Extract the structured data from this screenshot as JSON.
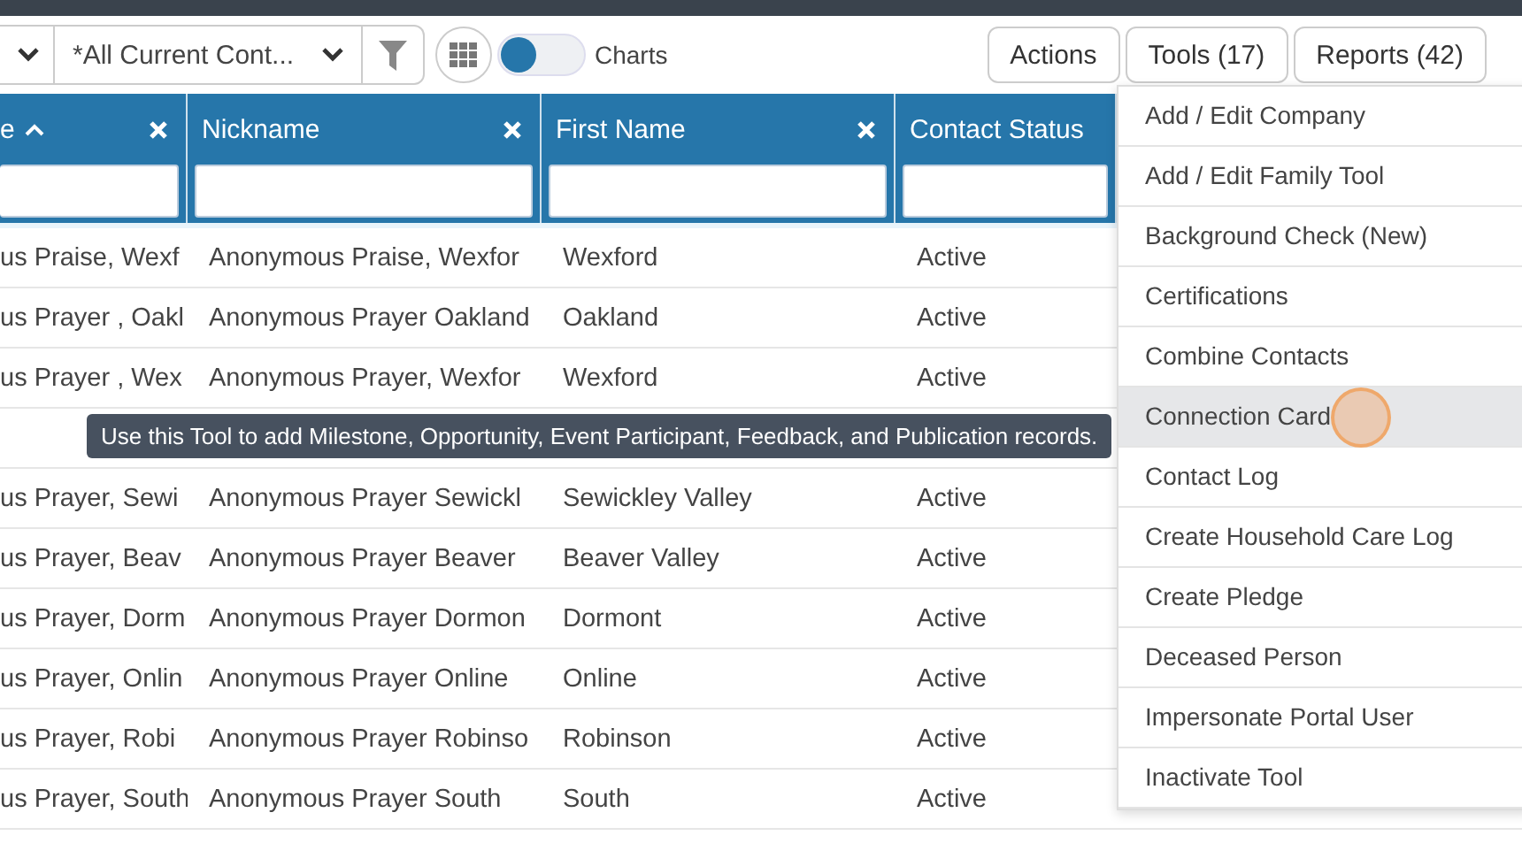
{
  "toolbar": {
    "view_select": {
      "value": "*All Current Cont..."
    },
    "charts_toggle": {
      "label": "Charts",
      "on": false
    },
    "buttons": [
      {
        "label": "Actions"
      },
      {
        "label": "Tools (17)"
      },
      {
        "label": "Reports (42)"
      }
    ]
  },
  "table": {
    "columns": [
      {
        "label": "e",
        "sorted": true,
        "removable": true
      },
      {
        "label": "Nickname",
        "sorted": false,
        "removable": true
      },
      {
        "label": "First Name",
        "sorted": false,
        "removable": true
      },
      {
        "label": "Contact Status",
        "sorted": false,
        "removable": false
      }
    ],
    "rows": [
      {
        "kind": "data",
        "cells": [
          "us Praise, Wexf",
          "Anonymous Praise, Wexfor",
          "Wexford",
          "Active"
        ]
      },
      {
        "kind": "data",
        "cells": [
          "us Prayer , Oakl",
          "Anonymous Prayer Oakland",
          "Oakland",
          "Active"
        ]
      },
      {
        "kind": "data",
        "cells": [
          "us Prayer , Wex",
          "Anonymous Prayer, Wexfor",
          "Wexford",
          "Active"
        ]
      },
      {
        "kind": "covered"
      },
      {
        "kind": "data",
        "cells": [
          "us Prayer, Sewi",
          "Anonymous Prayer Sewickl",
          "Sewickley Valley",
          "Active"
        ]
      },
      {
        "kind": "data",
        "cells": [
          "us Prayer, Beav",
          "Anonymous Prayer Beaver",
          "Beaver Valley",
          "Active"
        ]
      },
      {
        "kind": "data",
        "cells": [
          "us Prayer, Dorm",
          "Anonymous Prayer Dormon",
          "Dormont",
          "Active"
        ]
      },
      {
        "kind": "data",
        "cells": [
          "us Prayer, Onlin",
          "Anonymous Prayer Online",
          "Online",
          "Active"
        ]
      },
      {
        "kind": "data",
        "cells": [
          "us Prayer, Robi",
          "Anonymous Prayer Robinso",
          "Robinson",
          "Active"
        ]
      },
      {
        "kind": "data",
        "cells": [
          "us Prayer, South",
          "Anonymous Prayer South",
          "South",
          "Active"
        ]
      }
    ]
  },
  "tools_menu": {
    "items": [
      {
        "label": "Add / Edit Company",
        "highlighted": false
      },
      {
        "label": "Add / Edit Family Tool",
        "highlighted": false
      },
      {
        "label": "Background Check (New)",
        "highlighted": false
      },
      {
        "label": "Certifications",
        "highlighted": false
      },
      {
        "label": "Combine Contacts",
        "highlighted": false
      },
      {
        "label": "Connection Card",
        "highlighted": true
      },
      {
        "label": "Contact Log",
        "highlighted": false
      },
      {
        "label": "Create Household Care Log",
        "highlighted": false
      },
      {
        "label": "Create Pledge",
        "highlighted": false
      },
      {
        "label": "Deceased Person",
        "highlighted": false
      },
      {
        "label": "Impersonate Portal User",
        "highlighted": false
      },
      {
        "label": "Inactivate Tool",
        "highlighted": false
      }
    ]
  },
  "tooltip": {
    "text": "Use this Tool to add Milestone, Opportunity, Event Participant, Feedback, and Publication records."
  }
}
